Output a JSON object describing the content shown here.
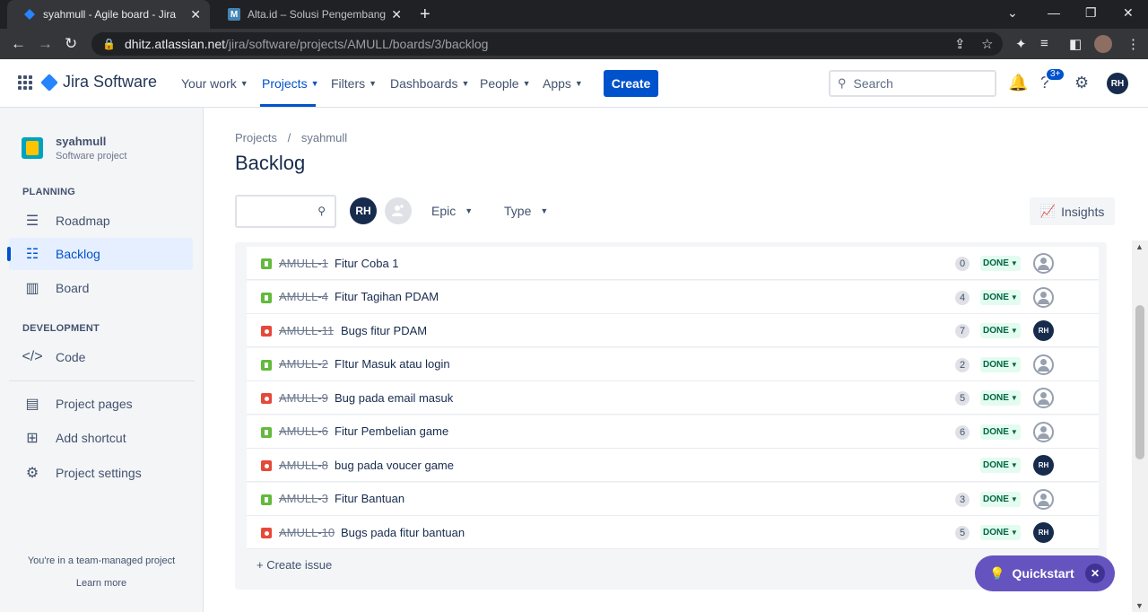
{
  "browser": {
    "tabs": [
      {
        "title": "syahmull - Agile board - Jira",
        "active": true
      },
      {
        "title": "Alta.id – Solusi Pengembangan S",
        "active": false
      }
    ],
    "url_host": "dhitz.atlassian.net",
    "url_path": "/jira/software/projects/AMULL/boards/3/backlog"
  },
  "topnav": {
    "logo": "Jira Software",
    "menus": [
      "Your work",
      "Projects",
      "Filters",
      "Dashboards",
      "People",
      "Apps"
    ],
    "create": "Create",
    "search_placeholder": "Search",
    "notification_badge": "3+",
    "avatar": "RH"
  },
  "sidebar": {
    "project_name": "syahmull",
    "project_type": "Software project",
    "planning_header": "PLANNING",
    "planning_items": [
      "Roadmap",
      "Backlog",
      "Board"
    ],
    "development_header": "DEVELOPMENT",
    "development_items": [
      "Code"
    ],
    "other_items": [
      "Project pages",
      "Add shortcut",
      "Project settings"
    ],
    "footer_note": "You're in a team-managed project",
    "learn_more": "Learn more"
  },
  "main": {
    "breadcrumb_projects": "Projects",
    "breadcrumb_sep": "/",
    "breadcrumb_project": "syahmull",
    "title": "Backlog",
    "filter_avatar": "RH",
    "epic_filter": "Epic",
    "type_filter": "Type",
    "insights": "Insights",
    "create_issue": "+ Create issue"
  },
  "issues": [
    {
      "type": "story",
      "key": "AMULL-1",
      "summary": "Fitur Coba 1",
      "estimate": "0",
      "status": "DONE",
      "assignee": "unassigned"
    },
    {
      "type": "story",
      "key": "AMULL-4",
      "summary": "Fitur Tagihan PDAM",
      "estimate": "4",
      "status": "DONE",
      "assignee": "unassigned"
    },
    {
      "type": "bug",
      "key": "AMULL-11",
      "summary": "Bugs fitur PDAM",
      "estimate": "7",
      "status": "DONE",
      "assignee": "RH"
    },
    {
      "type": "story",
      "key": "AMULL-2",
      "summary": "FItur Masuk atau login",
      "estimate": "2",
      "status": "DONE",
      "assignee": "unassigned"
    },
    {
      "type": "bug",
      "key": "AMULL-9",
      "summary": "Bug pada email masuk",
      "estimate": "5",
      "status": "DONE",
      "assignee": "unassigned"
    },
    {
      "type": "story",
      "key": "AMULL-6",
      "summary": "Fitur Pembelian game",
      "estimate": "6",
      "status": "DONE",
      "assignee": "unassigned"
    },
    {
      "type": "bug",
      "key": "AMULL-8",
      "summary": "bug pada voucer game",
      "estimate": "",
      "status": "DONE",
      "assignee": "RH"
    },
    {
      "type": "story",
      "key": "AMULL-3",
      "summary": "Fitur Bantuan",
      "estimate": "3",
      "status": "DONE",
      "assignee": "unassigned"
    },
    {
      "type": "bug",
      "key": "AMULL-10",
      "summary": "Bugs pada fitur bantuan",
      "estimate": "5",
      "status": "DONE",
      "assignee": "RH"
    }
  ],
  "quickstart": {
    "label": "Quickstart",
    "close": "✕"
  },
  "colors": {
    "primary": "#0052cc",
    "story": "#63ba3c",
    "bug": "#e5493a",
    "done_bg": "#e3fcef",
    "done_text": "#006644",
    "quickstart": "#6554c0"
  }
}
